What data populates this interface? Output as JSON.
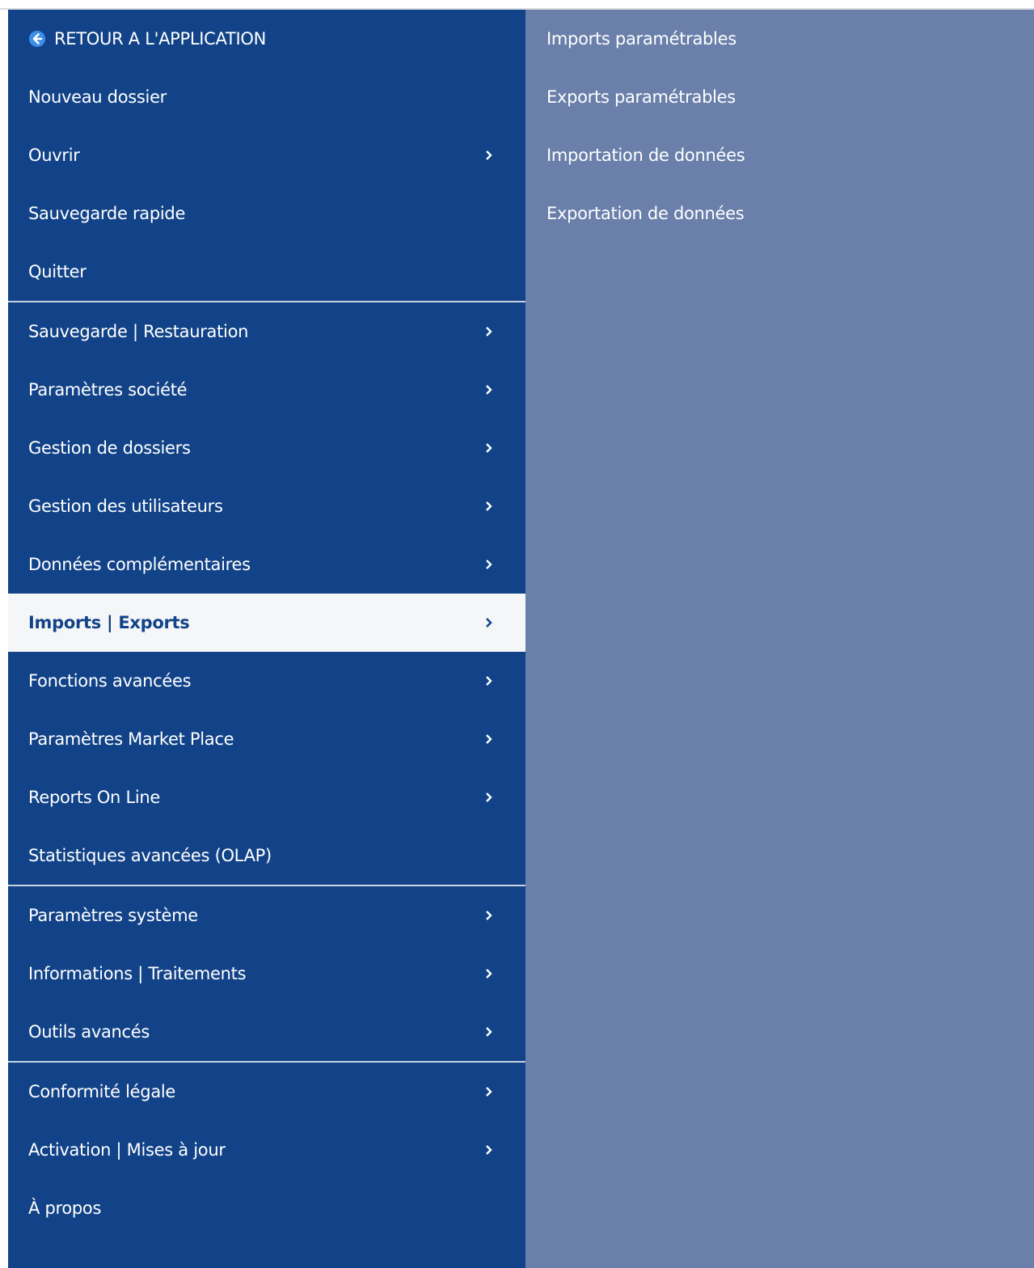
{
  "colors": {
    "menu_bg": "#124388",
    "submenu_bg": "#6a80aa",
    "active_bg": "#f4f6f8",
    "active_text": "#134389",
    "text": "#ffffff"
  },
  "menu": {
    "back_label": "RETOUR A L'APPLICATION",
    "back_icon": "arrow-left-circle-icon",
    "group1": [
      {
        "label": "Nouveau dossier"
      },
      {
        "label": "Ouvrir"
      },
      {
        "label": "Sauvegarde rapide"
      },
      {
        "label": "Quitter"
      }
    ],
    "group2": [
      {
        "label": "Sauvegarde | Restauration"
      },
      {
        "label": "Paramètres société"
      },
      {
        "label": "Gestion de dossiers"
      },
      {
        "label": "Gestion des utilisateurs"
      },
      {
        "label": "Données complémentaires"
      },
      {
        "label": "Imports | Exports"
      },
      {
        "label": "Fonctions avancées"
      },
      {
        "label": "Paramètres Market Place"
      },
      {
        "label": "Reports On Line"
      },
      {
        "label": "Statistiques avancées (OLAP)"
      }
    ],
    "group3": [
      {
        "label": "Paramètres système"
      },
      {
        "label": "Informations | Traitements"
      },
      {
        "label": "Outils avancés"
      }
    ],
    "group4": [
      {
        "label": "Conformité légale"
      },
      {
        "label": "Activation | Mises à jour"
      },
      {
        "label": "À propos"
      }
    ]
  },
  "submenu": {
    "items": [
      {
        "label": "Imports paramétrables"
      },
      {
        "label": "Exports paramétrables"
      },
      {
        "label": "Importation de données"
      },
      {
        "label": "Exportation de données"
      }
    ]
  }
}
